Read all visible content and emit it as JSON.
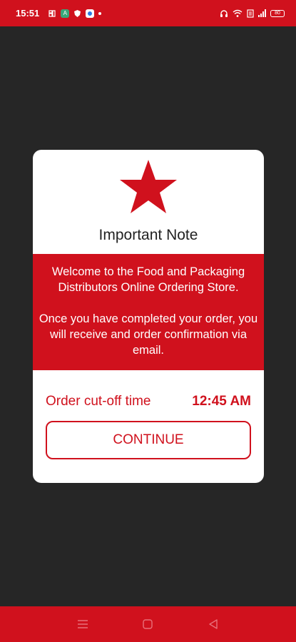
{
  "status_bar": {
    "time": "15:51",
    "battery": "80"
  },
  "dialog": {
    "title": "Important Note",
    "icon": "star-icon",
    "message_line1": "Welcome to the Food and Packaging Distributors Online Ordering Store.",
    "message_line2": "Once you have completed your order, you will receive and order confirmation via email.",
    "cutoff_label": "Order cut-off time",
    "cutoff_time": "12:45 AM",
    "continue_label": "CONTINUE"
  },
  "colors": {
    "brand_red": "#d0111d",
    "backdrop": "#262626",
    "dialog_bg": "#ffffff"
  },
  "nav_bar": {
    "icons": [
      "menu-icon",
      "home-icon",
      "back-icon"
    ]
  }
}
